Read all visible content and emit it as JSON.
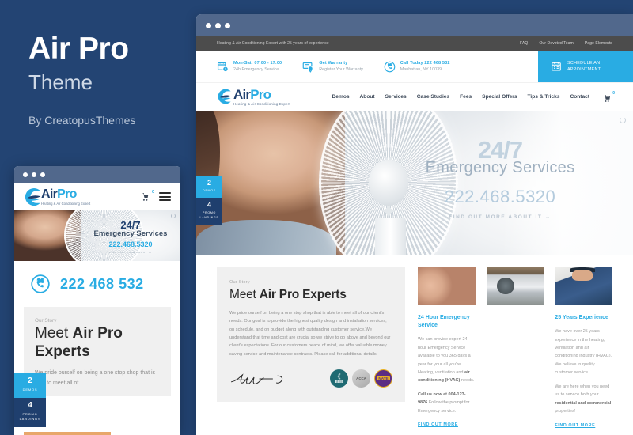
{
  "promo": {
    "title": "Air Pro",
    "subtitle": "Theme",
    "byline": "By CreatopusThemes"
  },
  "colors": {
    "background": "#234473",
    "accent": "#29ace3",
    "navy": "#1f3f6e",
    "topbar": "#4c4c4c",
    "browser_chrome": "#51688c"
  },
  "site": {
    "topbar": {
      "tagline": "Heating & Air Conditioning Expert with 25 years of experience",
      "links": [
        "FAQ",
        "Our Devoted Team",
        "Page Elements"
      ]
    },
    "info_strip": {
      "items": [
        {
          "icon": "calendar-clock-icon",
          "title": "Mon-Sat: 07:00 - 17:00",
          "subtitle": "24h Emergency Service"
        },
        {
          "icon": "certificate-icon",
          "title": "Get Warranty",
          "subtitle": "Register Your Warranty"
        },
        {
          "icon": "phone-24-icon",
          "title": "Call Today 222 468 532",
          "subtitle": "Manhattan, NY 10039"
        }
      ],
      "cta": {
        "icon": "calendar-icon",
        "line1": "SCHEDULE AN",
        "line2": "APPOINTMENT"
      }
    },
    "logo": {
      "air": "Air",
      "pro": "Pro",
      "tagline": "Heating & Air Conditioning Expert"
    },
    "nav": [
      "Demos",
      "About",
      "Services",
      "Case Studies",
      "Fees",
      "Special Offers",
      "Tips & Tricks",
      "Contact"
    ],
    "cart_count": "0",
    "hero": {
      "headline_247": "24/7",
      "headline_sub": "Emergency Services",
      "phone": "222.468.5320",
      "cta": "FIND OUT MORE ABOUT IT →",
      "spinner": "loading-spinner-icon"
    },
    "side_tabs": [
      {
        "number": "2",
        "label": "DEMOS",
        "style": "blue"
      },
      {
        "number": "4",
        "label": "PROMO LANDINGS",
        "style": "navy"
      }
    ],
    "story": {
      "kicker": "Our Story",
      "title_light": "Meet ",
      "title_bold": "Air Pro Experts",
      "body": "We pride ourself on being a one stop shop that is able to meet all of our client's needs. Our goal is to provide the highest quality design and installation services, on schedule, and on budget along with outstanding customer service.We understand that time and cost are crucial so we strive to go above and beyond our client's expectations. For our customers peace of mind, we offer valuable money saving service and maintenance contracts. Please call for additional details.",
      "signature": "signature-icon",
      "certifications": [
        "BBB",
        "ACCA",
        "NATE"
      ]
    },
    "cards": [
      {
        "image": "thermostat-photo",
        "title": "24 Hour Emergency Service",
        "body_1": "We can provide expert 24 hour Emergency Service available to you 365 days a year for your all you're Heating, ventilation and ",
        "body_1_bold": "air conditioning (HVAC)",
        "body_1_end": " needs.",
        "body_2_bold": "Call us now at 004-123-9876",
        "body_2": " Follow the prompt for Emergency service.",
        "link": "FIND OUT MORE"
      },
      {
        "image": "ac-units-photo",
        "title": "25 Years Experience",
        "body_1": "We have over 25 years experience in the heating, ventilation and air conditioning industry (HVAC). We believe in quality customer service.",
        "body_2": "We are here when you need us to service both your ",
        "body_2_bold": "residential and commercial",
        "body_2_end": " properties!",
        "link": "FIND OUT MORE"
      }
    ]
  },
  "mobile": {
    "logo": {
      "air": "Air",
      "pro": "Pro",
      "tagline": "Heating & Air Conditioning Expert"
    },
    "cart_count": "0",
    "menu_icon": "hamburger-menu-icon",
    "hero": {
      "headline_247": "24/7",
      "headline_sub": "Emergency Services",
      "phone": "222.468.5320",
      "cta": "FIND OUT MORE ABOUT IT"
    },
    "phone_block": {
      "icon": "phone-24-icon",
      "number": "222 468 532"
    },
    "side_tabs": [
      {
        "number": "2",
        "label": "DEMOS",
        "style": "blue"
      },
      {
        "number": "4",
        "label": "PROMO LANDINGS",
        "style": "navy"
      }
    ],
    "story": {
      "kicker": "Our Story",
      "title_light": "Meet ",
      "title_bold": "Air Pro Experts",
      "body": "We pride ourself on being a one stop shop that is able to meet all of"
    }
  }
}
